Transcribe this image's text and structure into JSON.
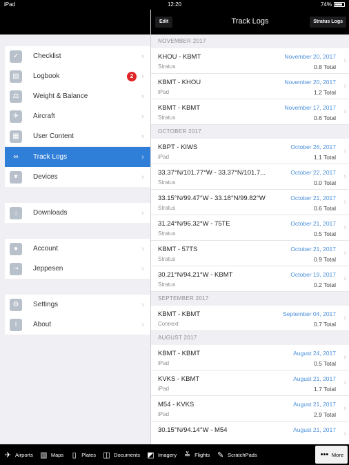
{
  "status": {
    "device": "iPad",
    "time": "12:20",
    "battery": "74%"
  },
  "sidebar": {
    "items": [
      {
        "label": "Checklist",
        "icon": "check-icon",
        "glyph": "✓"
      },
      {
        "label": "Logbook",
        "icon": "book-icon",
        "glyph": "▤",
        "badge": "2"
      },
      {
        "label": "Weight & Balance",
        "icon": "scale-icon",
        "glyph": "⚖"
      },
      {
        "label": "Aircraft",
        "icon": "airplane-icon",
        "glyph": "✈"
      },
      {
        "label": "User Content",
        "icon": "folder-icon",
        "glyph": "▦"
      },
      {
        "label": "Track Logs",
        "icon": "track-icon",
        "glyph": "∞",
        "selected": true
      },
      {
        "label": "Devices",
        "icon": "device-icon",
        "glyph": "▾"
      },
      {
        "label": "Downloads",
        "icon": "download-icon",
        "glyph": "↓"
      },
      {
        "label": "Account",
        "icon": "person-icon",
        "glyph": "●"
      },
      {
        "label": "Jeppesen",
        "icon": "jeppesen-icon",
        "glyph": "➝"
      },
      {
        "label": "Settings",
        "icon": "gear-icon",
        "glyph": "⚙"
      },
      {
        "label": "About",
        "icon": "info-icon",
        "glyph": "i"
      }
    ]
  },
  "nav": {
    "edit": "Edit",
    "title": "Track Logs",
    "stratus": "Stratus Logs"
  },
  "sections": [
    {
      "header": "NOVEMBER 2017",
      "rows": [
        {
          "route": "KHOU - KBMT",
          "source": "Stratus",
          "date": "November 20, 2017",
          "total": "0.8 Total"
        },
        {
          "route": "KBMT - KHOU",
          "source": "iPad",
          "date": "November 20, 2017",
          "total": "1.2 Total"
        },
        {
          "route": "KBMT - KBMT",
          "source": "Stratus",
          "date": "November 17, 2017",
          "total": "0.6 Total"
        }
      ]
    },
    {
      "header": "OCTOBER 2017",
      "rows": [
        {
          "route": "KBPT - KIWS",
          "source": "iPad",
          "date": "October 26, 2017",
          "total": "1.1 Total"
        },
        {
          "route": "33.37°N/101.77°W - 33.37°N/101.7...",
          "source": "Stratus",
          "date": "October 22, 2017",
          "total": "0.0 Total"
        },
        {
          "route": "33.15°N/99.47°W - 33.18°N/99.82°W",
          "source": "Stratus",
          "date": "October 21, 2017",
          "total": "0.6 Total"
        },
        {
          "route": "31.24°N/96.32°W - 75TE",
          "source": "Stratus",
          "date": "October 21, 2017",
          "total": "0.5 Total"
        },
        {
          "route": "KBMT - 57TS",
          "source": "Stratus",
          "date": "October 21, 2017",
          "total": "0.9 Total"
        },
        {
          "route": "30.21°N/94.21°W - KBMT",
          "source": "Stratus",
          "date": "October 19, 2017",
          "total": "0.2 Total"
        }
      ]
    },
    {
      "header": "SEPTEMBER 2017",
      "rows": [
        {
          "route": "KBMT - KBMT",
          "source": "Connext",
          "date": "September 04, 2017",
          "total": "0.7 Total"
        }
      ]
    },
    {
      "header": "AUGUST 2017",
      "rows": [
        {
          "route": "KBMT - KBMT",
          "source": "iPad",
          "date": "August 24, 2017",
          "total": "0.5 Total"
        },
        {
          "route": "KVKS - KBMT",
          "source": "iPad",
          "date": "August 21, 2017",
          "total": "1.7 Total"
        },
        {
          "route": "M54 - KVKS",
          "source": "iPad",
          "date": "August 21, 2017",
          "total": "2.9 Total"
        },
        {
          "route": "30.15°N/94.14°W - M54",
          "source": "",
          "date": "August 21, 2017",
          "total": ""
        }
      ]
    }
  ],
  "tabs": [
    {
      "label": "Airports",
      "icon": "airports-icon",
      "glyph": "✈"
    },
    {
      "label": "Maps",
      "icon": "maps-icon",
      "glyph": "▥"
    },
    {
      "label": "Plates",
      "icon": "plates-icon",
      "glyph": "▯"
    },
    {
      "label": "Documents",
      "icon": "documents-icon",
      "glyph": "◫"
    },
    {
      "label": "Imagery",
      "icon": "imagery-icon",
      "glyph": "◩"
    },
    {
      "label": "Flights",
      "icon": "flights-icon",
      "glyph": "≚"
    },
    {
      "label": "ScratchPads",
      "icon": "scratchpads-icon",
      "glyph": "✎"
    },
    {
      "label": "More",
      "icon": "more-icon",
      "glyph": "•••"
    }
  ],
  "colors": {
    "accent": "#2f7ed7",
    "date_blue": "#4a8fd9",
    "badge_red": "#e02626"
  }
}
